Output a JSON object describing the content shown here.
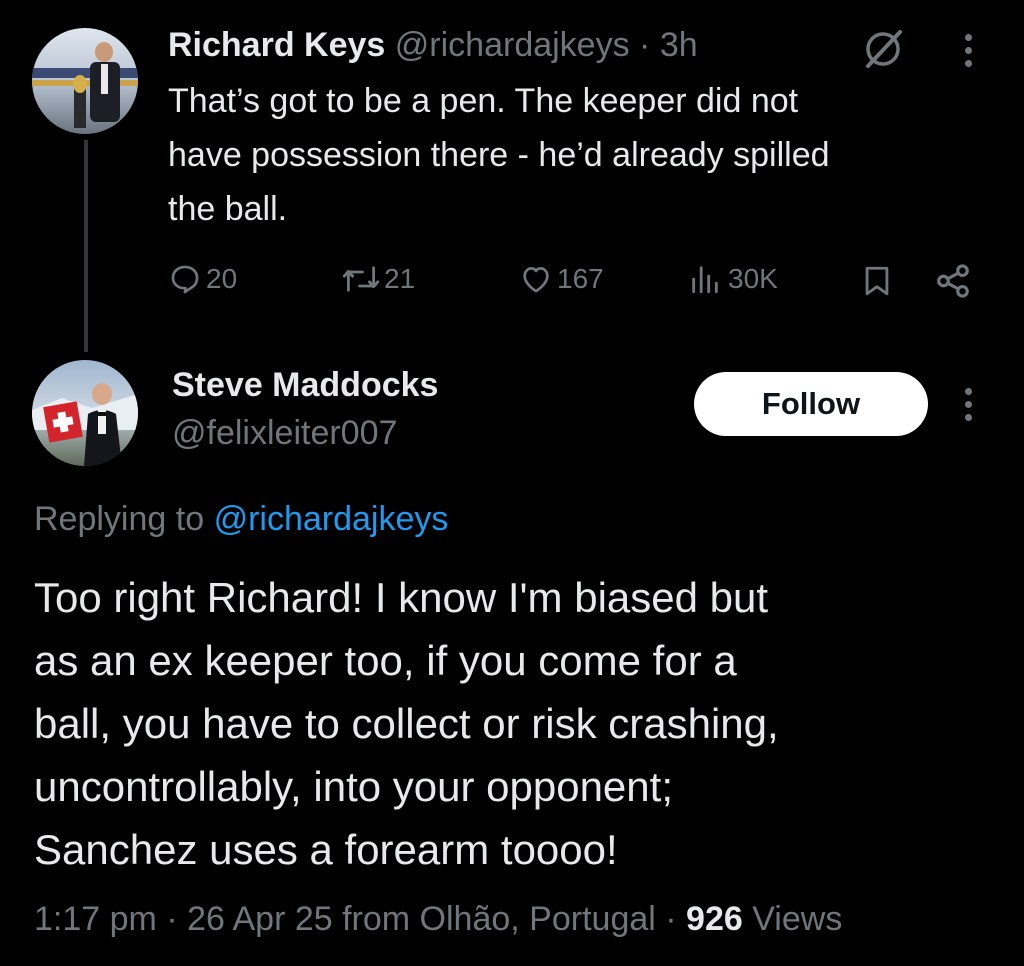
{
  "parent_tweet": {
    "display_name": "Richard Keys",
    "handle": "@richardajkeys",
    "separator": "·",
    "time": "3h",
    "text_lines": [
      "That’s got to be a pen. The keeper did not",
      "have possession there - he’d already spilled",
      "the ball."
    ],
    "metrics": {
      "replies": "20",
      "reposts": "21",
      "likes": "167",
      "views": "30K"
    }
  },
  "reply_tweet": {
    "display_name": "Steve Maddocks",
    "handle": "@felixleiter007",
    "follow_label": "Follow",
    "replying_prefix": "Replying to",
    "replying_to": "@richardajkeys",
    "text_lines": [
      "Too right Richard! I know I'm biased but",
      "as an ex keeper too, if you come for a",
      "ball, you have to collect or risk crashing,",
      "uncontrollably, into your opponent;",
      "Sanchez uses a forearm toooo!"
    ],
    "footer": {
      "time": "1:17 pm",
      "dot1": "·",
      "date": "26 Apr 25",
      "from": "from Olhão, Portugal",
      "dot2": "·",
      "views_count": "926",
      "views_label": "Views"
    }
  },
  "icons": {
    "grok": "grok-icon",
    "more": "more-options-icon",
    "reply": "reply-icon",
    "repost": "repost-icon",
    "like": "like-icon",
    "views": "views-icon",
    "bookmark": "bookmark-icon",
    "share": "share-icon"
  }
}
